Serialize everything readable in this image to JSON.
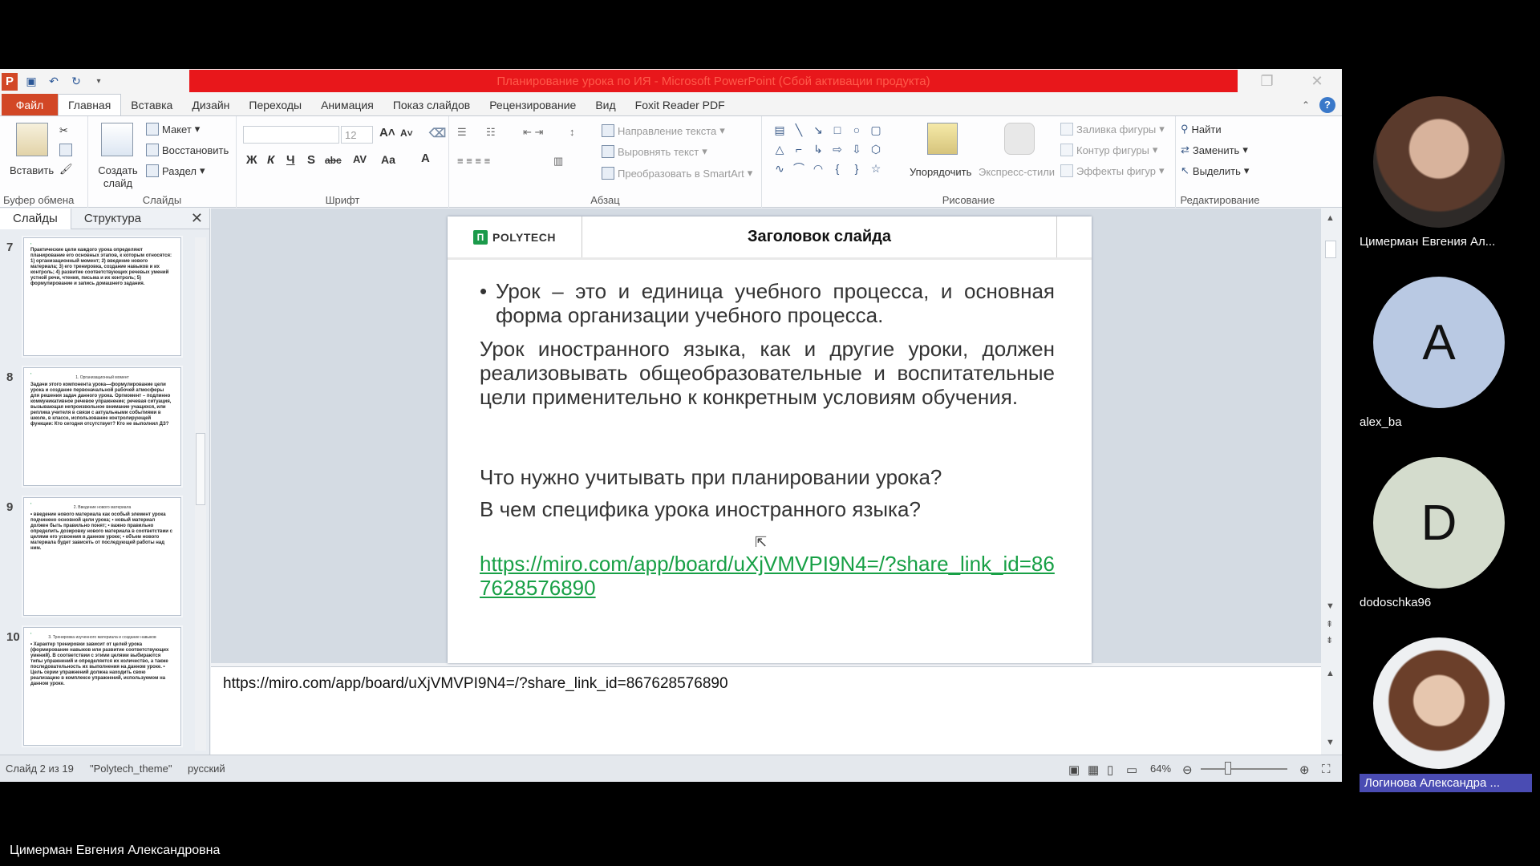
{
  "window": {
    "title": "Планирование урока по ИЯ - Microsoft PowerPoint (Сбой активации продукта)",
    "tabs": [
      "Файл",
      "Главная",
      "Вставка",
      "Дизайн",
      "Переходы",
      "Анимация",
      "Показ слайдов",
      "Рецензирование",
      "Вид",
      "Foxit Reader PDF"
    ],
    "active_tab": "Главная"
  },
  "ribbon": {
    "clipboard": {
      "paste": "Вставить",
      "label": "Буфер обмена"
    },
    "slides": {
      "new_slide": "Создать слайд",
      "layout": "Макет",
      "reset": "Восстановить",
      "section": "Раздел",
      "label": "Слайды"
    },
    "font": {
      "size": "12",
      "label": "Шрифт"
    },
    "paragraph": {
      "text_direction": "Направление текста",
      "align_text": "Выровнять текст",
      "smartart": "Преобразовать в SmartArt",
      "label": "Абзац"
    },
    "drawing": {
      "arrange": "Упорядочить",
      "quick_styles": "Экспресс-стили",
      "fill": "Заливка фигуры",
      "outline": "Контур фигуры",
      "effects": "Эффекты фигур",
      "label": "Рисование"
    },
    "editing": {
      "find": "Найти",
      "replace": "Заменить",
      "select": "Выделить",
      "label": "Редактирование"
    }
  },
  "panel": {
    "tab_slides": "Слайды",
    "tab_outline": "Структура",
    "thumbnails": [
      {
        "num": "7",
        "title": "",
        "text": "Практические цели каждого урока определяют планирование его основных этапов, к которым относятся: 1) организационный момент; 2) введение нового материала; 3) его тренировка, создание навыков и их контроль; 4) развитие соответствующих речевых умений устной речи, чтения, письма и их контроль; 5) формулирование и запись домашнего задания."
      },
      {
        "num": "8",
        "title": "1. Организационный момент",
        "text": "Задачи этого компонента урока—формулирование цели урока и создание первоначальной рабочей атмосферы для решения задач данного урока. Оргмомент – подлинно коммуникативное речевое упражнение; речевая ситуация, вызывающая непроизвольное внимание учащихся, или реплика учителя в связи с актуальными событиями в школе, в классе, использование контролирующей функции: Кто сегодня отсутствует? Кто не выполнил ДЗ?"
      },
      {
        "num": "9",
        "title": "2. Введение нового материала",
        "text": "• введение нового материала как особый элемент урока подчинено основной цели урока; • новый материал должен быть правильно понят; • важно правильно определить дозировку нового материала в соответствии с целями его усвоения в данном уроке; • объем нового материала будет зависеть от последующей работы над ним."
      },
      {
        "num": "10",
        "title": "3. Тренировка изученного материала и создание навыков",
        "text": "• Характер тренировки зависит от целей урока (формирование навыков или развитие соответствующих умений). В соответствии с этими целями выбираются типы упражнений и определяется их количество, а также последовательность их выполнения на данном уроке. • Цель серии упражнений должна находить свою реализацию в комплексе упражнений, используемом на данном уроке."
      }
    ]
  },
  "slide": {
    "logo": "POLYTECH",
    "title": "Заголовок слайда",
    "bullet": "Урок – это и единица учебного процесса, и основная форма организации учебного процесса.",
    "paragraph": "Урок иностранного языка, как и другие уроки, должен реализовывать общеобразовательные и воспитательные цели применительно к конкретным условиям обучения.",
    "question1": "Что нужно учитывать при планировании урока?",
    "question2": "В чем специфика урока иностранного языка?",
    "link": "https://miro.com/app/board/uXjVMVPI9N4=/?share_link_id=867628576890"
  },
  "notes": {
    "text": "https://miro.com/app/board/uXjVMVPI9N4=/?share_link_id=867628576890"
  },
  "status": {
    "slide": "Слайд 2 из 19",
    "theme": "\"Polytech_theme\"",
    "language": "русский",
    "zoom": "64%"
  },
  "participants": [
    {
      "name": "Цимерман Евгения Ал...",
      "initial": "",
      "bg": "#8a6a5a"
    },
    {
      "name": "alex_ba",
      "initial": "A",
      "bg": "#b9c9e3"
    },
    {
      "name": "dodoschka96",
      "initial": "D",
      "bg": "#d4dccd"
    },
    {
      "name": "Логинова Александра ...",
      "initial": "",
      "bg": "#c9b8a8"
    }
  ],
  "speaker": "Цимерман Евгения Александровна",
  "colors": {
    "title_bar": "#e8171b",
    "file_tab": "#d24726",
    "link": "#18a046",
    "highlight_name": "#4a4cb3"
  }
}
